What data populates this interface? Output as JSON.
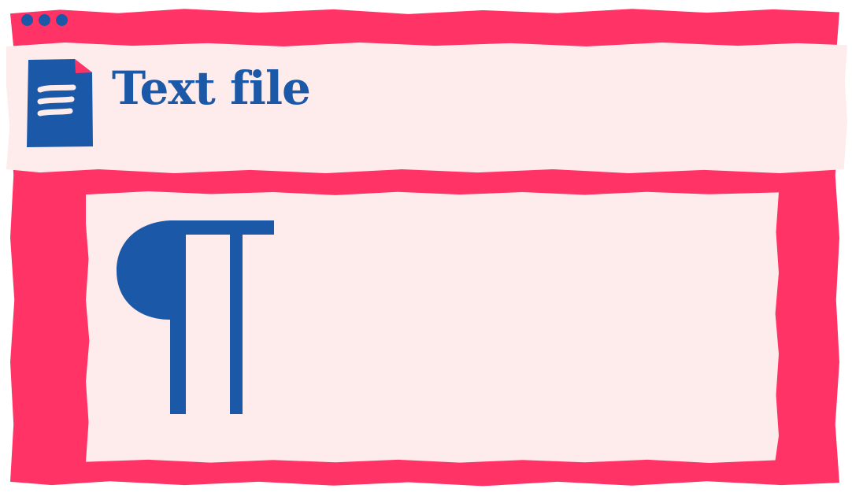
{
  "window": {
    "title": "Text file",
    "controls": [
      "window-dot",
      "window-dot",
      "window-dot"
    ]
  },
  "header": {
    "icon": "text-file-icon"
  },
  "content": {
    "symbol_icon": "pilcrow-icon"
  },
  "colors": {
    "accent": "#ff3366",
    "paper": "#fdeceb",
    "ink": "#1c58a8"
  }
}
